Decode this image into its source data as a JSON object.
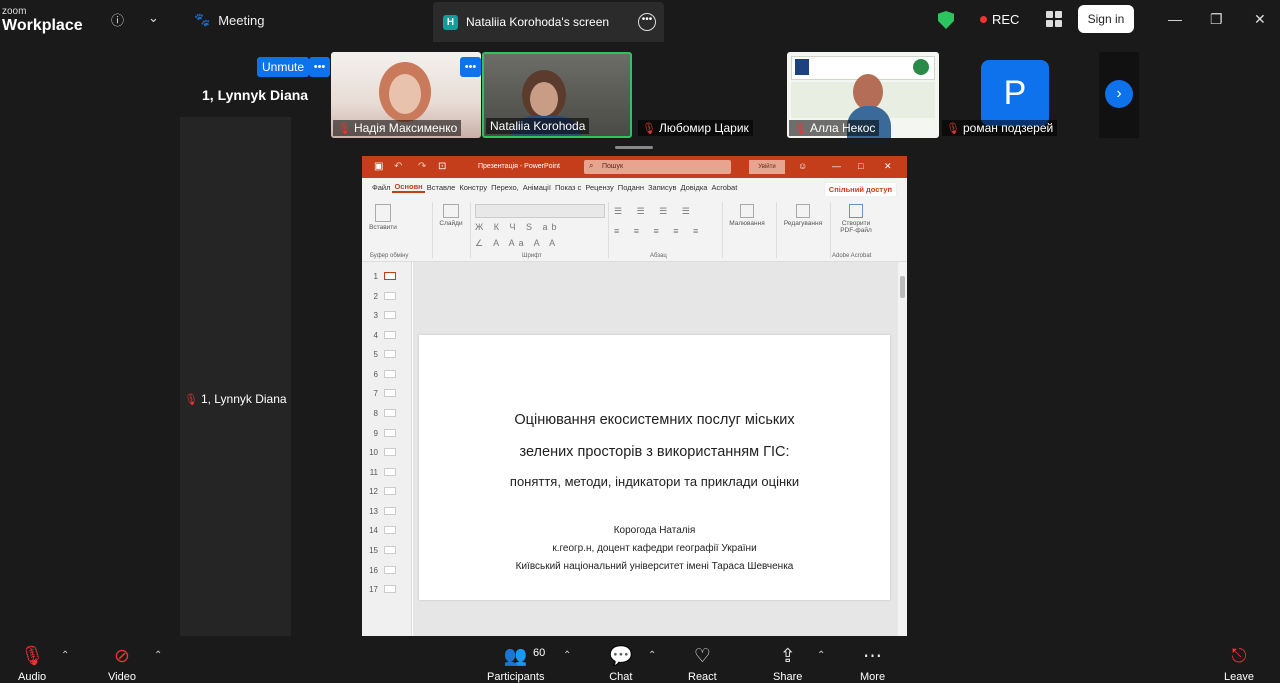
{
  "topbar": {
    "logo_small": "zoom",
    "logo_big": "Workplace",
    "meeting_label": "Meeting",
    "share_badge": "H",
    "share_title": "Nataliia Korohoda's screen",
    "rec_label": "REC",
    "signin_label": "Sign in"
  },
  "participants_strip": {
    "unmute_label": "Unmute",
    "self_name": "1, Lynnyk Diana",
    "self_tag": "1, Lynnyk Diana",
    "tiles": [
      {
        "name": "Надія Максименко"
      },
      {
        "name": "Nataliia Korohoda"
      },
      {
        "name": "Любомир Царик"
      },
      {
        "name": "Алла Некос"
      },
      {
        "name": "роман подзерей",
        "avatar_letter": "P"
      }
    ],
    "next_arrow": "›"
  },
  "powerpoint": {
    "title": "Презентація - PowerPoint",
    "search": "Пошук",
    "login": "Увійти",
    "share": "Спільний доступ",
    "tabs": [
      "Файл",
      "Основн",
      "Вставле",
      "Констру",
      "Перехо,",
      "Анімації",
      "Показ с",
      "Рецензу",
      "Поданн",
      "Записув",
      "Довідка",
      "Acrobat"
    ],
    "groups": {
      "clipboard": "Буфер обміну",
      "paste": "Вставити",
      "slides": "Слайди",
      "font": "Шрифт",
      "paragraph": "Абзац",
      "drawing": "Малювання",
      "editing": "Редагування",
      "create_pdf": "Створити PDF-файл",
      "adobe": "Adobe Acrobat"
    },
    "slide_numbers": [
      "1",
      "2",
      "3",
      "4",
      "5",
      "6",
      "7",
      "8",
      "9",
      "10",
      "11",
      "12",
      "13",
      "14",
      "15",
      "16",
      "17"
    ],
    "slide": {
      "title_line1": "Оцінювання екосистемних послуг міських",
      "title_line2": "зелених просторів з використанням ГІС:",
      "subtitle": "поняття, методи, індикатори та приклади оцінки",
      "author": "Корогода Наталія",
      "position": "к.геогр.н, доцент кафедри географії України",
      "university": "Київський національний університет імені Тараса Шевченка"
    }
  },
  "bottombar": {
    "audio": "Audio",
    "video": "Video",
    "participants": "Participants",
    "participants_count": "60",
    "chat": "Chat",
    "react": "React",
    "share": "Share",
    "more": "More",
    "leave": "Leave"
  },
  "colors": {
    "zoom_blue": "#0e72ed",
    "ppt_red": "#c43e1c",
    "active_border": "#2bc45f"
  }
}
